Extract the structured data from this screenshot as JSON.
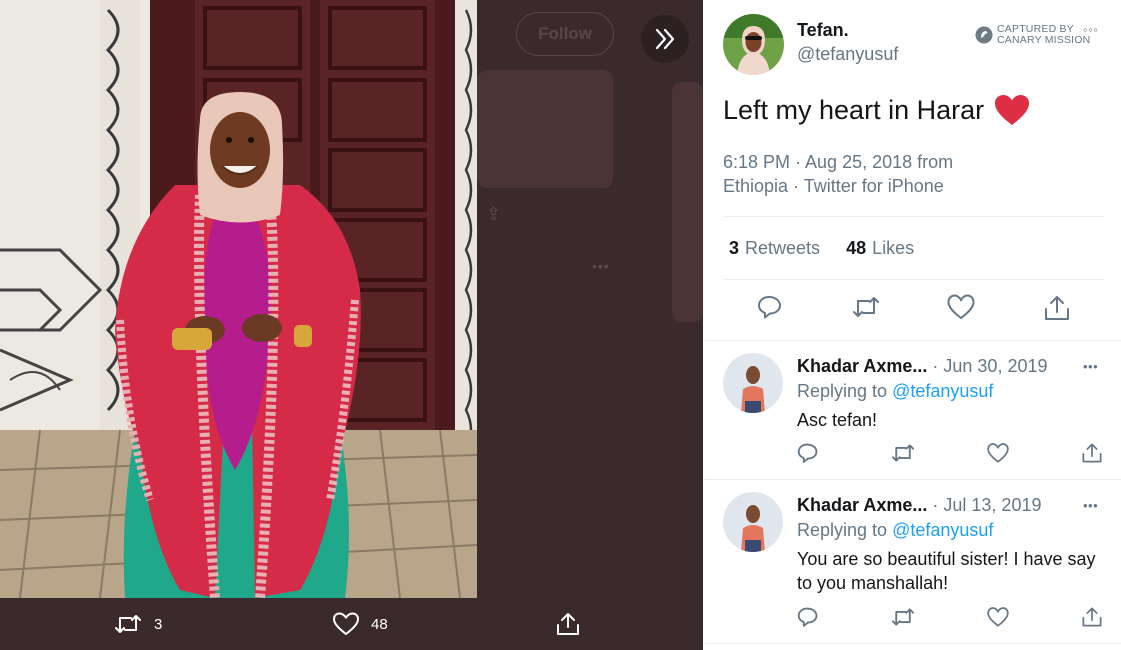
{
  "media": {
    "follow_label": "Follow",
    "retweet_count": "3",
    "like_count": "48",
    "icons": [
      "retweet-icon",
      "heart-icon",
      "share-icon",
      "expand-icon"
    ]
  },
  "tweet": {
    "author_name": "Tefan.",
    "author_handle": "@tefanyusuf",
    "canary_line1": "CAPTURED BY",
    "canary_line2": "CANARY MISSION",
    "text": "Left my heart in Harar",
    "meta_line1": "6:18 PM · Aug 25, 2018 from",
    "meta_line2": "Ethiopia · Twitter for iPhone",
    "retweets_count": "3",
    "retweets_label": "Retweets",
    "likes_count": "48",
    "likes_label": "Likes",
    "heart_color": "#e0245e",
    "link_color": "#1da1f2"
  },
  "replies": [
    {
      "name": "Khadar Axme...",
      "date": "· Jun 30, 2019",
      "replying_prefix": "Replying to",
      "replying_handle": "@tefanyusuf",
      "text": "Asc tefan!"
    },
    {
      "name": "Khadar Axme...",
      "date": "· Jul 13, 2019",
      "replying_prefix": "Replying to",
      "replying_handle": "@tefanyusuf",
      "text": "You are so beautiful sister! I have say to you manshallah!"
    }
  ]
}
